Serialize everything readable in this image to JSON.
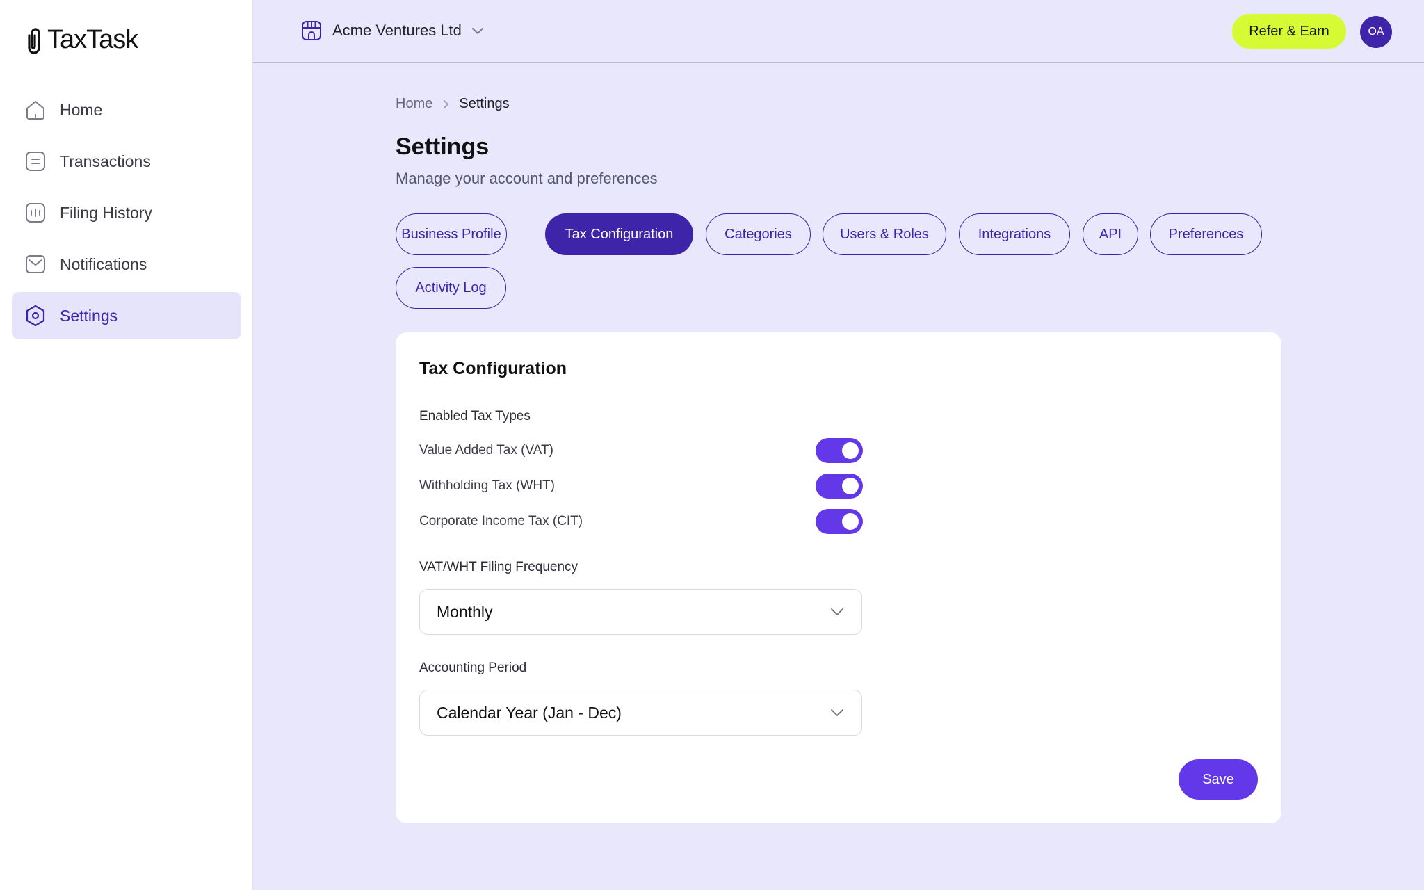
{
  "brand": {
    "name": "TaxTask"
  },
  "sidebar": {
    "items": [
      {
        "label": "Home",
        "icon": "home-icon",
        "active": false
      },
      {
        "label": "Transactions",
        "icon": "list-icon",
        "active": false
      },
      {
        "label": "Filing History",
        "icon": "history-icon",
        "active": false
      },
      {
        "label": "Notifications",
        "icon": "inbox-icon",
        "active": false
      },
      {
        "label": "Settings",
        "icon": "settings-icon",
        "active": true
      }
    ]
  },
  "header": {
    "org_name": "Acme Ventures Ltd",
    "refer_label": "Refer & Earn",
    "avatar_initials": "OA"
  },
  "breadcrumb": {
    "home": "Home",
    "current": "Settings"
  },
  "page": {
    "title": "Settings",
    "subtitle": "Manage your account and preferences"
  },
  "tabs": [
    {
      "label": "Business Profile",
      "active": false
    },
    {
      "label": "Tax Configuration",
      "active": true
    },
    {
      "label": "Categories",
      "active": false
    },
    {
      "label": "Users & Roles",
      "active": false
    },
    {
      "label": "Integrations",
      "active": false
    },
    {
      "label": "API",
      "active": false
    },
    {
      "label": "Preferences",
      "active": false
    },
    {
      "label": "Activity Log",
      "active": false
    }
  ],
  "card": {
    "title": "Tax Configuration",
    "enabled_label": "Enabled Tax Types",
    "tax_types": [
      {
        "label": "Value Added Tax (VAT)",
        "enabled": true
      },
      {
        "label": "Withholding Tax (WHT)",
        "enabled": true
      },
      {
        "label": "Corporate Income Tax (CIT)",
        "enabled": true
      }
    ],
    "frequency_label": "VAT/WHT Filing Frequency",
    "frequency_value": "Monthly",
    "period_label": "Accounting Period",
    "period_value": "Calendar Year (Jan - Dec)",
    "save_label": "Save"
  },
  "colors": {
    "accent": "#3d24a8",
    "toggle": "#6338e8",
    "refer_bg": "#d6fb35",
    "page_bg": "#e8e7fc"
  }
}
